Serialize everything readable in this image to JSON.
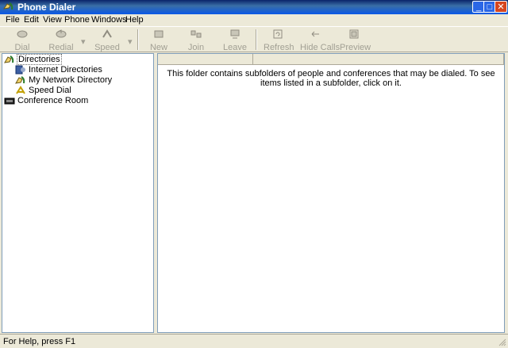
{
  "window": {
    "title": "Phone Dialer"
  },
  "menu": [
    "File",
    "Edit",
    "View",
    "Phone",
    "Windows",
    "Help"
  ],
  "toolbar": {
    "dial": "Dial",
    "redial": "Redial",
    "speed": "Speed",
    "new": "New",
    "join": "Join",
    "leave": "Leave",
    "refresh": "Refresh",
    "hide_calls": "Hide Calls",
    "preview": "Preview"
  },
  "tree": {
    "directories": "Directories",
    "internet": "Internet Directories",
    "network": "My Network Directory",
    "speed_dial": "Speed Dial",
    "conference": "Conference Room"
  },
  "content": {
    "message": "This folder contains subfolders of people and conferences that may be dialed.  To see items listed in a subfolder, click on it."
  },
  "status": {
    "text": "For Help, press F1"
  },
  "colors": {
    "title_bar": "#0A58E6",
    "panel": "#ECE9D8",
    "border": "#7F9DB9"
  }
}
